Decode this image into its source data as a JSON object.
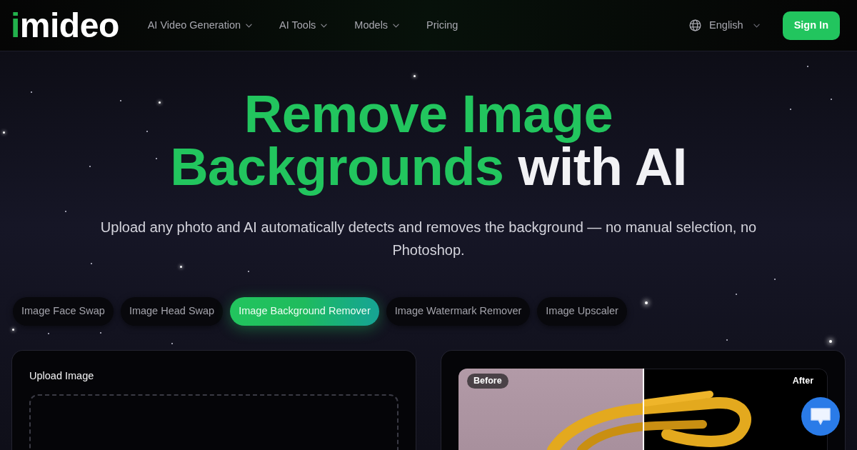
{
  "header": {
    "logo": {
      "accent": "i",
      "text": "mideo"
    },
    "nav": [
      {
        "label": "AI Video Generation",
        "has_menu": true
      },
      {
        "label": "AI Tools",
        "has_menu": true
      },
      {
        "label": "Models",
        "has_menu": true
      },
      {
        "label": "Pricing",
        "has_menu": false
      }
    ],
    "language": {
      "label": "English"
    },
    "sign_in": "Sign In"
  },
  "hero": {
    "title": [
      {
        "text": "Remove Image Backgrounds",
        "accent": true
      },
      {
        "text": "with AI",
        "accent": false
      }
    ],
    "subtitle": "Upload any photo and AI automatically detects and removes the background — no manual selection, no Photoshop."
  },
  "tools": [
    {
      "label": "Image Face Swap",
      "selected": false
    },
    {
      "label": "Image Head Swap",
      "selected": false
    },
    {
      "label": "Image Background Remover",
      "selected": true
    },
    {
      "label": "Image Watermark Remover",
      "selected": false
    },
    {
      "label": "Image Upscaler",
      "selected": false
    }
  ],
  "upload_card": {
    "title": "Upload Image"
  },
  "preview_card": {
    "before_label": "Before",
    "after_label": "After"
  }
}
